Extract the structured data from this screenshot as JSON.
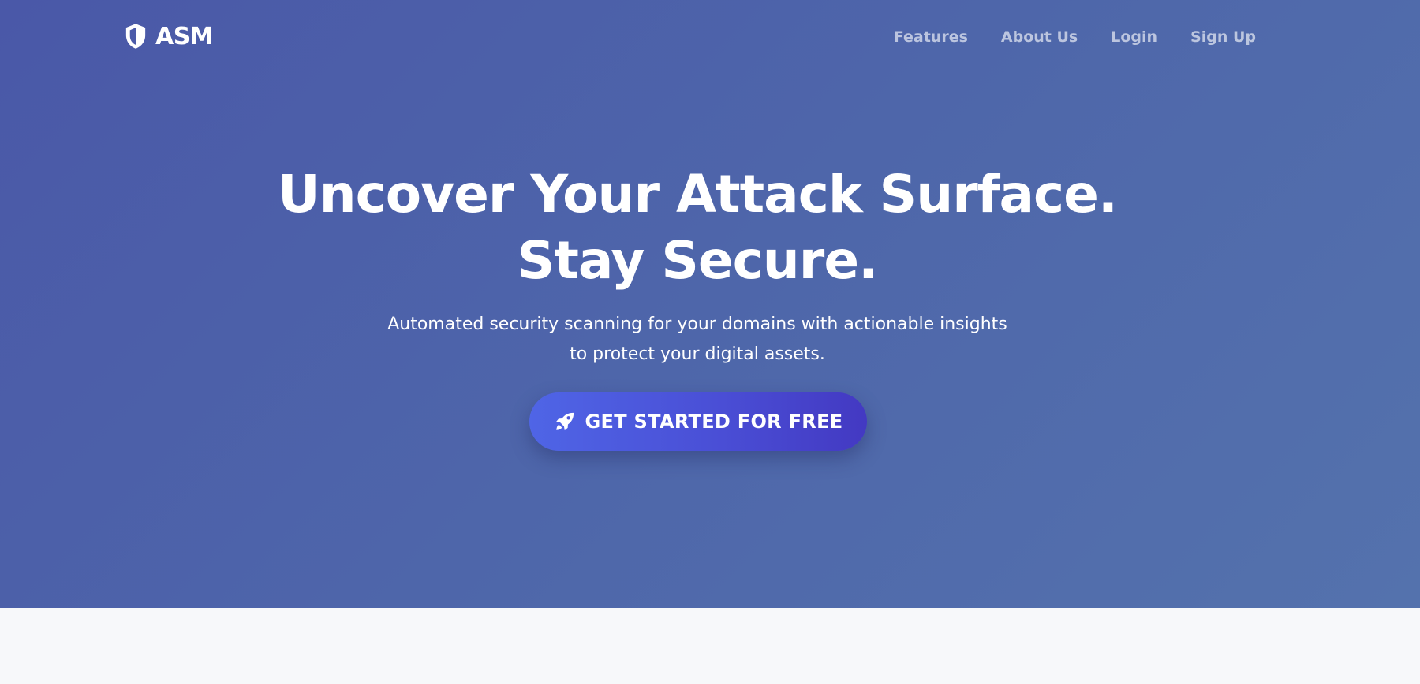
{
  "brand": {
    "name": "ASM",
    "icon": "shield-icon"
  },
  "nav": {
    "items": [
      {
        "label": "Features"
      },
      {
        "label": "About Us"
      },
      {
        "label": "Login"
      },
      {
        "label": "Sign Up"
      }
    ]
  },
  "hero": {
    "headline_line1": "Uncover Your Attack Surface.",
    "headline_line2": "Stay Secure.",
    "subtitle_line1": "Automated security scanning for your domains with actionable insights",
    "subtitle_line2": "to protect your digital assets.",
    "cta": {
      "label": "GET STARTED FOR FREE",
      "icon": "rocket-icon"
    }
  },
  "colors": {
    "hero_gradient_start": "#4a58a8",
    "hero_gradient_end": "#5472ad",
    "cta_gradient_start": "#4f65e6",
    "cta_gradient_end": "#4339c2",
    "page_background": "#f7f8fa",
    "nav_text": "#c4cbe3"
  }
}
